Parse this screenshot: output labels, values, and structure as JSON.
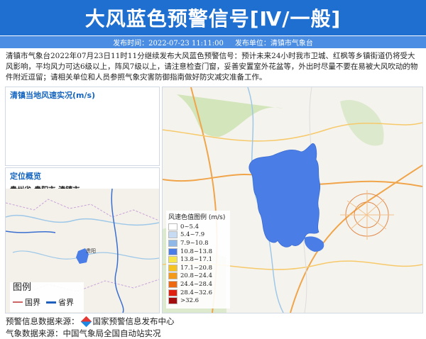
{
  "header": {
    "title": "大风蓝色预警信号[Ⅳ/一般]",
    "publish_time": "发布时间：2022-07-23 11:11:00",
    "publisher": "发布单位：清镇市气象台"
  },
  "description": "清镇市气象台2022年07月23日11时11分继续发布大风蓝色预警信号：预计未来24小时我市卫城、红枫等乡镇街道仍将受大风影响，平均风力可达6级以上，阵风7级以上，请注意检查门窗，妥善安置室外花盆等，外出时尽量不要在易被大风吹动的物件附近逗留；请相关单位和人员参照气象灾害防御指南做好防灾减灾准备工作。",
  "wind_panel": {
    "title": "清镇当地风速实况(m/s)"
  },
  "location_panel": {
    "title": "定位概览",
    "subtitle": "贵州省-贵阳市-清镇市",
    "map_label": "贵阳",
    "legend_title": "图例",
    "legend_country": "国界",
    "legend_province": "省界"
  },
  "map_legend": {
    "title": "风速色值图例 (m/s)",
    "items": [
      {
        "label": "0~5.4",
        "color": "#ffffff"
      },
      {
        "label": "5.4~7.9",
        "color": "#c7dcf2"
      },
      {
        "label": "7.9~10.8",
        "color": "#8fb8e8"
      },
      {
        "label": "10.8~13.8",
        "color": "#4a7ee6"
      },
      {
        "label": "13.8~17.1",
        "color": "#f6e64a"
      },
      {
        "label": "17.1~20.8",
        "color": "#f5c420"
      },
      {
        "label": "20.8~24.4",
        "color": "#f39a1a"
      },
      {
        "label": "24.4~28.4",
        "color": "#ee6a12"
      },
      {
        "label": "28.4~32.6",
        "color": "#e02010"
      },
      {
        "label": ">32.6",
        "color": "#a40d0d"
      }
    ]
  },
  "footer": {
    "source_label": "预警信息数据来源：",
    "source_name": "国家预警信息发布中心",
    "data_source": "气象数据来源：中国气象局全国自动站实况"
  },
  "colors": {
    "header_bg": "#1e6fd0",
    "subbar_bg": "#4a8de2",
    "warning_area": "#4a7ee6",
    "panel_title": "#1565c0"
  }
}
